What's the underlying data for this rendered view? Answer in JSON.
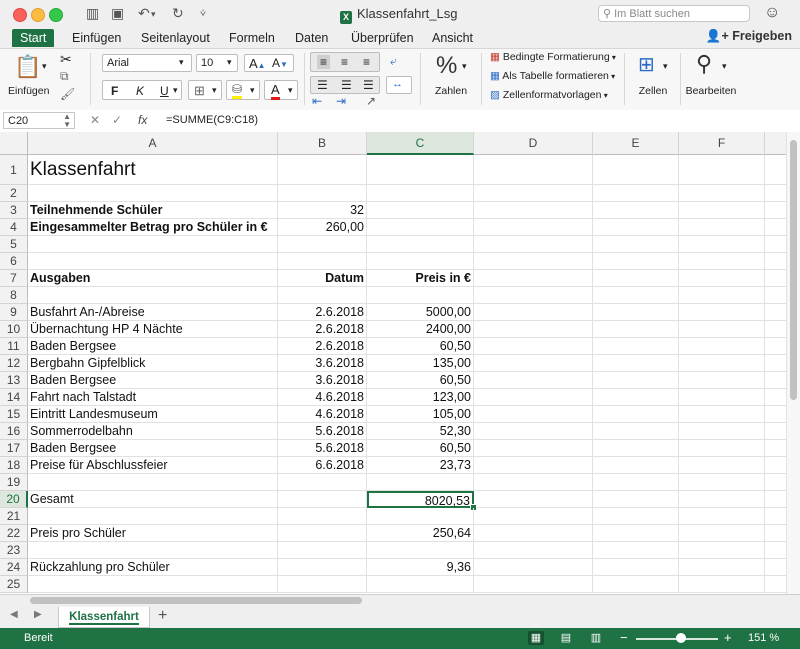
{
  "window": {
    "title": "Klassenfahrt_Lsg",
    "search_placeholder": "Im Blatt suchen",
    "file_icon": "excel-file-icon"
  },
  "ribbon_tabs": [
    "Start",
    "Einfügen",
    "Seitenlayout",
    "Formeln",
    "Daten",
    "Überprüfen",
    "Ansicht"
  ],
  "active_tab": "Start",
  "share_label": "Freigeben",
  "ribbon": {
    "paste_label": "Einfügen",
    "font_name": "Arial",
    "font_size": "10",
    "grow_font": "A",
    "shrink_font": "A",
    "bold": "F",
    "italic": "K",
    "underline": "U",
    "font_color_glyph": "A",
    "number_label": "Zahlen",
    "percent_glyph": "%",
    "cond_format": "Bedingte Formatierung",
    "as_table": "Als Tabelle formatieren",
    "cell_styles": "Zellenformatvorlagen",
    "cells_label": "Zellen",
    "edit_label": "Bearbeiten"
  },
  "formula_bar": {
    "name_box": "C20",
    "fx": "fx",
    "formula": "=SUMME(C9:C18)"
  },
  "columns": [
    "A",
    "B",
    "C",
    "D",
    "E",
    "F"
  ],
  "active_cell": "C20",
  "rows": [
    {
      "n": "1",
      "a": "Klassenfahrt",
      "b": "",
      "c": ""
    },
    {
      "n": "2",
      "a": "",
      "b": "",
      "c": ""
    },
    {
      "n": "3",
      "a": "Teilnehmende Schüler",
      "b": "32",
      "c": ""
    },
    {
      "n": "4",
      "a": "Eingesammelter Betrag pro Schüler in €",
      "b": "260,00",
      "c": ""
    },
    {
      "n": "5",
      "a": "",
      "b": "",
      "c": ""
    },
    {
      "n": "6",
      "a": "",
      "b": "",
      "c": ""
    },
    {
      "n": "7",
      "a": "Ausgaben",
      "b": "Datum",
      "c": "Preis in €"
    },
    {
      "n": "8",
      "a": "",
      "b": "",
      "c": ""
    },
    {
      "n": "9",
      "a": "Busfahrt An-/Abreise",
      "b": "2.6.2018",
      "c": "5000,00"
    },
    {
      "n": "10",
      "a": "Übernachtung HP 4 Nächte",
      "b": "2.6.2018",
      "c": "2400,00"
    },
    {
      "n": "11",
      "a": "Baden Bergsee",
      "b": "2.6.2018",
      "c": "60,50"
    },
    {
      "n": "12",
      "a": "Bergbahn Gipfelblick",
      "b": "3.6.2018",
      "c": "135,00"
    },
    {
      "n": "13",
      "a": "Baden Bergsee",
      "b": "3.6.2018",
      "c": "60,50"
    },
    {
      "n": "14",
      "a": "Fahrt nach Talstadt",
      "b": "4.6.2018",
      "c": "123,00"
    },
    {
      "n": "15",
      "a": "Eintritt Landesmuseum",
      "b": "4.6.2018",
      "c": "105,00"
    },
    {
      "n": "16",
      "a": "Sommerrodelbahn",
      "b": "5.6.2018",
      "c": "52,30"
    },
    {
      "n": "17",
      "a": "Baden Bergsee",
      "b": "5.6.2018",
      "c": "60,50"
    },
    {
      "n": "18",
      "a": "Preise für Abschlussfeier",
      "b": "6.6.2018",
      "c": "23,73"
    },
    {
      "n": "19",
      "a": "",
      "b": "",
      "c": ""
    },
    {
      "n": "20",
      "a": "Gesamt",
      "b": "",
      "c": "8020,53"
    },
    {
      "n": "21",
      "a": "",
      "b": "",
      "c": ""
    },
    {
      "n": "22",
      "a": "Preis pro Schüler",
      "b": "",
      "c": "250,64"
    },
    {
      "n": "23",
      "a": "",
      "b": "",
      "c": ""
    },
    {
      "n": "24",
      "a": "Rückzahlung pro Schüler",
      "b": "",
      "c": "9,36"
    },
    {
      "n": "25",
      "a": "",
      "b": "",
      "c": ""
    }
  ],
  "sheet_tab": "Klassenfahrt",
  "status": {
    "ready": "Bereit",
    "zoom": "151 %"
  },
  "colors": {
    "accent": "#1f7244"
  }
}
